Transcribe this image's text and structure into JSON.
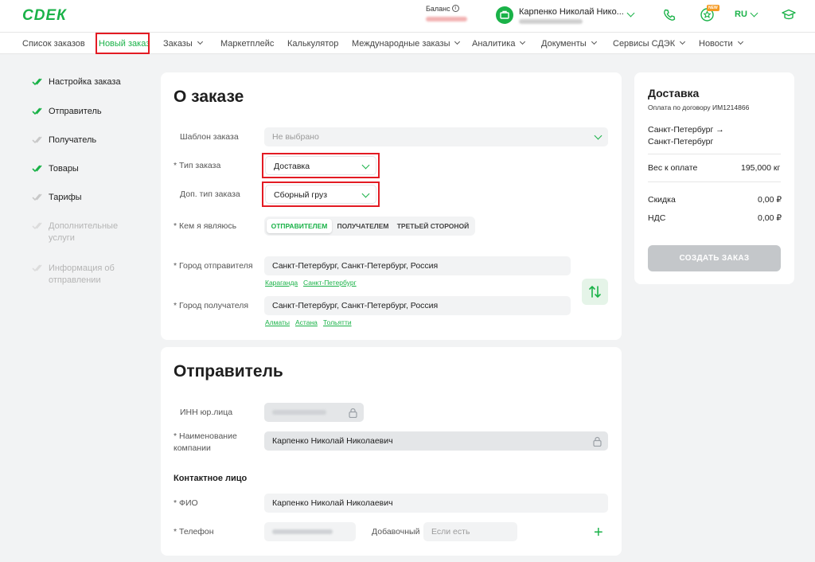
{
  "header": {
    "logo": "СDЕК",
    "balance_label": "Баланс",
    "user_name": "Карпенко Николай Нико...",
    "new_badge": "NEW",
    "lang": "RU",
    "accent": "#1ab248"
  },
  "nav": {
    "items": [
      {
        "label": "Список заказов"
      },
      {
        "label": "Новый заказ"
      },
      {
        "label": "Заказы"
      },
      {
        "label": "Маркетплейс"
      },
      {
        "label": "Калькулятор"
      },
      {
        "label": "Международные заказы"
      },
      {
        "label": "Аналитика"
      },
      {
        "label": "Документы"
      },
      {
        "label": "Сервисы СДЭК"
      },
      {
        "label": "Новости"
      }
    ]
  },
  "steps": [
    {
      "label": "Настройка заказа",
      "state": "done"
    },
    {
      "label": "Отправитель",
      "state": "done"
    },
    {
      "label": "Получатель",
      "state": "pending"
    },
    {
      "label": "Товары",
      "state": "done"
    },
    {
      "label": "Тарифы",
      "state": "pending"
    },
    {
      "label": "Дополнительные услуги",
      "state": "disabled"
    },
    {
      "label": "Информация об отправлении",
      "state": "disabled"
    }
  ],
  "order": {
    "title": "О заказе",
    "template_label": "Шаблон заказа",
    "template_placeholder": "Не выбрано",
    "type_label": "* Тип заказа",
    "type_value": "Доставка",
    "extra_type_label": "Доп. тип заказа",
    "extra_type_value": "Сборный груз",
    "role_label": "* Кем я являюсь",
    "roles": [
      "ОТПРАВИТЕЛЕМ",
      "ПОЛУЧАТЕЛЕМ",
      "ТРЕТЬЕЙ СТОРОНОЙ"
    ],
    "sender_city_label": "* Город отправителя",
    "sender_city_value": "Санкт-Петербург, Санкт-Петербург, Россия",
    "sender_quick": [
      "Караганда",
      "Санкт-Петербург"
    ],
    "receiver_city_label": "* Город получателя",
    "receiver_city_value": "Санкт-Петербург, Санкт-Петербург, Россия",
    "receiver_quick": [
      "Алматы",
      "Астана",
      "Тольятти"
    ]
  },
  "sender": {
    "title": "Отправитель",
    "inn_label": "ИНН юр.лица",
    "company_label": "* Наименование компании",
    "company_value": "Карпенко Николай Николаевич",
    "contact_title": "Контактное лицо",
    "fio_label": "* ФИО",
    "fio_value": "Карпенко Николай Николаевич",
    "phone_label": "* Телефон",
    "ext_label": "Добавочный",
    "ext_placeholder": "Если есть"
  },
  "summary": {
    "title": "Доставка",
    "contract": "Оплата по договору ИМ1214866",
    "route_from": "Санкт-Петербург →",
    "route_to": "Санкт-Петербург",
    "weight_label": "Вес к оплате",
    "weight_value": "195,000 кг",
    "discount_label": "Скидка",
    "discount_value": "0,00 ₽",
    "vat_label": "НДС",
    "vat_value": "0,00 ₽",
    "create_button": "СОЗДАТЬ ЗАКАЗ"
  }
}
